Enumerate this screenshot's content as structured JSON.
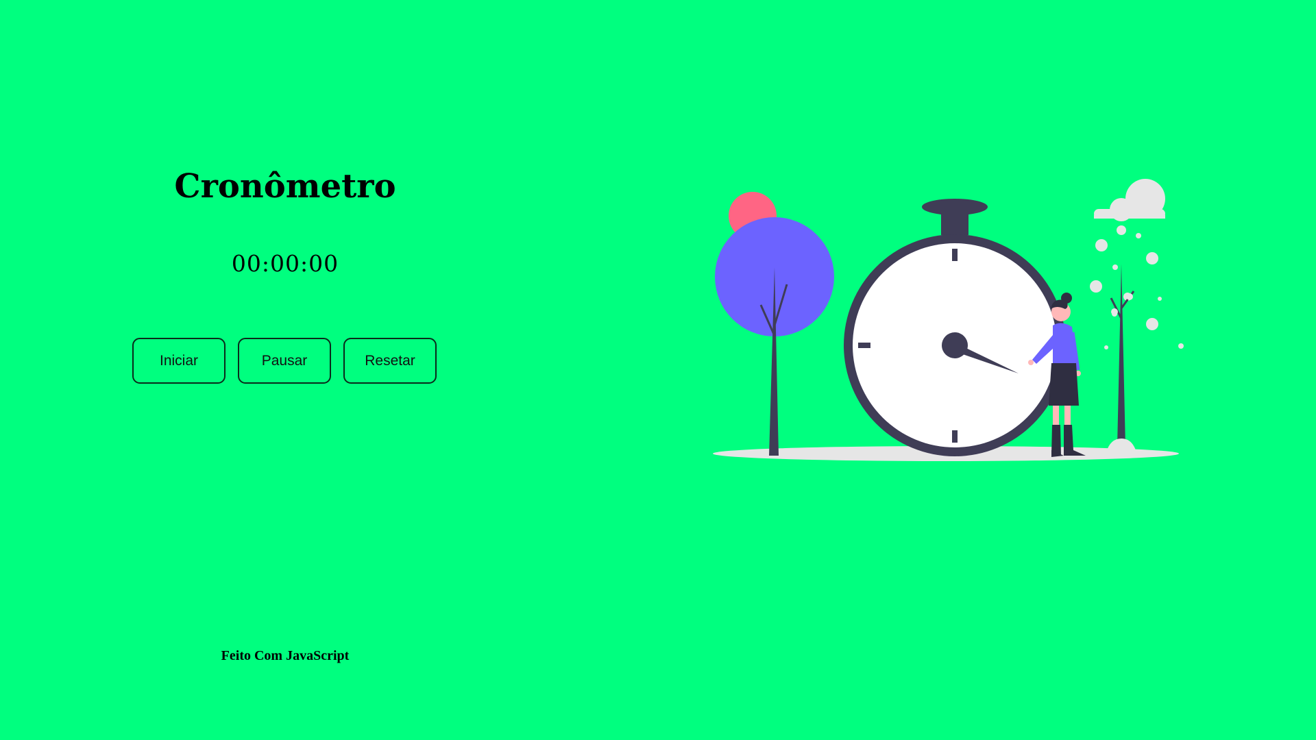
{
  "app": {
    "title": "Cronômetro",
    "timer_display": "00:00:00",
    "footer": "Feito Com JavaScript"
  },
  "controls": {
    "start_label": "Iniciar",
    "pause_label": "Pausar",
    "reset_label": "Resetar"
  },
  "illustration": {
    "icon": "stopwatch-woman-illustration"
  },
  "colors": {
    "background": "#00ff7f",
    "tree_purple": "#6c63ff",
    "tree_sun_pink": "#ff6584",
    "dark": "#3f3d56",
    "cloud": "#e6e6e6"
  }
}
